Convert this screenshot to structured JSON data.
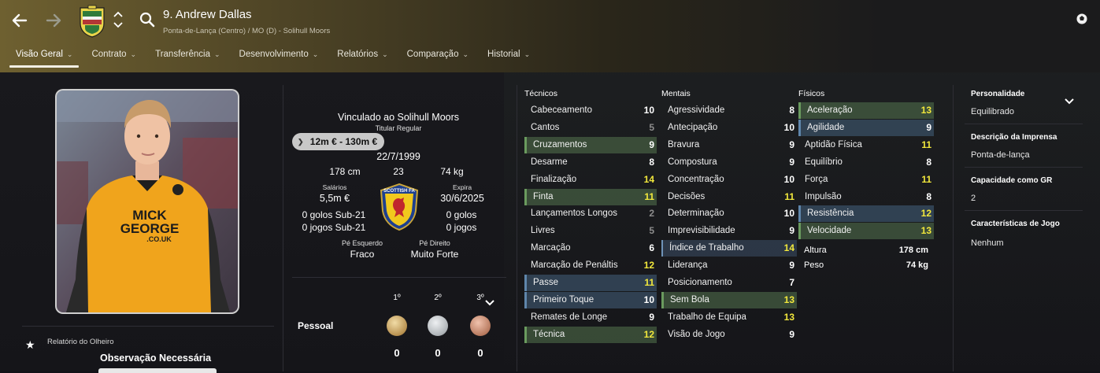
{
  "header": {
    "player_name": "9. Andrew Dallas",
    "subtitle": "Ponta-de-Lança (Centro) / MO (D) - Solihull Moors",
    "icons": [
      "back-arrow-icon",
      "forward-arrow-icon",
      "club-crest-icon",
      "up-down-icon",
      "search-icon",
      "football-icon"
    ]
  },
  "tabs": [
    {
      "label": "Visão Geral",
      "active": true
    },
    {
      "label": "Contrato"
    },
    {
      "label": "Transferência"
    },
    {
      "label": "Desenvolvimento"
    },
    {
      "label": "Relatórios"
    },
    {
      "label": "Comparação"
    },
    {
      "label": "Historial"
    }
  ],
  "overview": {
    "contract_line": "Vinculado ao Solihull Moors",
    "status": "Titular Regular",
    "value": "12m € - 130m €",
    "dob": "22/7/1999",
    "height": "178 cm",
    "age": "23",
    "weight": "74 kg",
    "salary_label": "Salários",
    "salary": "5,5m €",
    "expiry_label": "Expira",
    "expiry": "30/6/2025",
    "left_goals": "0 golos Sub-21",
    "left_games": "0 jogos Sub-21",
    "right_goals": "0 golos",
    "right_games": "0 jogos",
    "left_foot_label": "Pé Esquerdo",
    "left_foot": "Fraco",
    "right_foot_label": "Pé Direito",
    "right_foot": "Muito Forte",
    "badge_text": "SCOTTISH FA"
  },
  "awards": {
    "row_label": "Pessoal",
    "places": [
      "1º",
      "2º",
      "3º"
    ],
    "counts": [
      "0",
      "0",
      "0"
    ],
    "medal_colors": [
      "#c9a86a",
      "#bfc3c6",
      "#c58f74"
    ]
  },
  "scout": {
    "label": "Relatório do Olheiro",
    "value": "Observação Necessária"
  },
  "tecnicos": {
    "title": "Técnicos",
    "items": [
      {
        "name": "Cabeceamento",
        "value": "10",
        "hl": "",
        "color": "wh"
      },
      {
        "name": "Cantos",
        "value": "5",
        "hl": "",
        "color": "gr"
      },
      {
        "name": "Cruzamentos",
        "value": "9",
        "hl": "green",
        "color": "wh"
      },
      {
        "name": "Desarme",
        "value": "8",
        "hl": "",
        "color": "wh"
      },
      {
        "name": "Finalização",
        "value": "14",
        "hl": "",
        "color": "yl"
      },
      {
        "name": "Finta",
        "value": "11",
        "hl": "green",
        "color": "yl"
      },
      {
        "name": "Lançamentos Longos",
        "value": "2",
        "hl": "",
        "color": "gr"
      },
      {
        "name": "Livres",
        "value": "5",
        "hl": "",
        "color": "gr"
      },
      {
        "name": "Marcação",
        "value": "6",
        "hl": "",
        "color": "wh"
      },
      {
        "name": "Marcação de Penáltis",
        "value": "12",
        "hl": "",
        "color": "yl"
      },
      {
        "name": "Passe",
        "value": "11",
        "hl": "blue",
        "color": "yl"
      },
      {
        "name": "Primeiro Toque",
        "value": "10",
        "hl": "blue",
        "color": "wh"
      },
      {
        "name": "Remates de Longe",
        "value": "9",
        "hl": "",
        "color": "wh"
      },
      {
        "name": "Técnica",
        "value": "12",
        "hl": "green",
        "color": "yl"
      }
    ]
  },
  "mentais": {
    "title": "Mentais",
    "items": [
      {
        "name": "Agressividade",
        "value": "8",
        "hl": "",
        "color": "wh"
      },
      {
        "name": "Antecipação",
        "value": "10",
        "hl": "",
        "color": "wh"
      },
      {
        "name": "Bravura",
        "value": "9",
        "hl": "",
        "color": "wh"
      },
      {
        "name": "Compostura",
        "value": "9",
        "hl": "",
        "color": "wh"
      },
      {
        "name": "Concentração",
        "value": "10",
        "hl": "",
        "color": "wh"
      },
      {
        "name": "Decisões",
        "value": "11",
        "hl": "",
        "color": "yl"
      },
      {
        "name": "Determinação",
        "value": "10",
        "hl": "",
        "color": "wh"
      },
      {
        "name": "Imprevisibilidade",
        "value": "9",
        "hl": "",
        "color": "wh"
      },
      {
        "name": "Índice de Trabalho",
        "value": "14",
        "hl": "blue2",
        "color": "yl"
      },
      {
        "name": "Liderança",
        "value": "9",
        "hl": "",
        "color": "wh"
      },
      {
        "name": "Posicionamento",
        "value": "7",
        "hl": "",
        "color": "wh"
      },
      {
        "name": "Sem Bola",
        "value": "13",
        "hl": "green",
        "color": "yl"
      },
      {
        "name": "Trabalho de Equipa",
        "value": "13",
        "hl": "",
        "color": "yl"
      },
      {
        "name": "Visão de Jogo",
        "value": "9",
        "hl": "",
        "color": "wh"
      }
    ]
  },
  "fisicos": {
    "title": "Físicos",
    "items": [
      {
        "name": "Aceleração",
        "value": "13",
        "hl": "green",
        "color": "yl"
      },
      {
        "name": "Agilidade",
        "value": "9",
        "hl": "blue",
        "color": "wh"
      },
      {
        "name": "Aptidão Física",
        "value": "11",
        "hl": "",
        "color": "yl"
      },
      {
        "name": "Equilíbrio",
        "value": "8",
        "hl": "",
        "color": "wh"
      },
      {
        "name": "Força",
        "value": "11",
        "hl": "",
        "color": "yl"
      },
      {
        "name": "Impulsão",
        "value": "8",
        "hl": "",
        "color": "wh"
      },
      {
        "name": "Resistência",
        "value": "12",
        "hl": "blue",
        "color": "yl"
      },
      {
        "name": "Velocidade",
        "value": "13",
        "hl": "green",
        "color": "yl"
      }
    ],
    "height_label": "Altura",
    "height": "178 cm",
    "weight_label": "Peso",
    "weight": "74 kg"
  },
  "right_panel": {
    "personality_label": "Personalidade",
    "personality": "Equilibrado",
    "press_label": "Descrição da Imprensa",
    "press": "Ponta-de-lança",
    "gk_label": "Capacidade como GR",
    "gk": "2",
    "traits_label": "Características de Jogo",
    "traits": "Nenhum"
  }
}
